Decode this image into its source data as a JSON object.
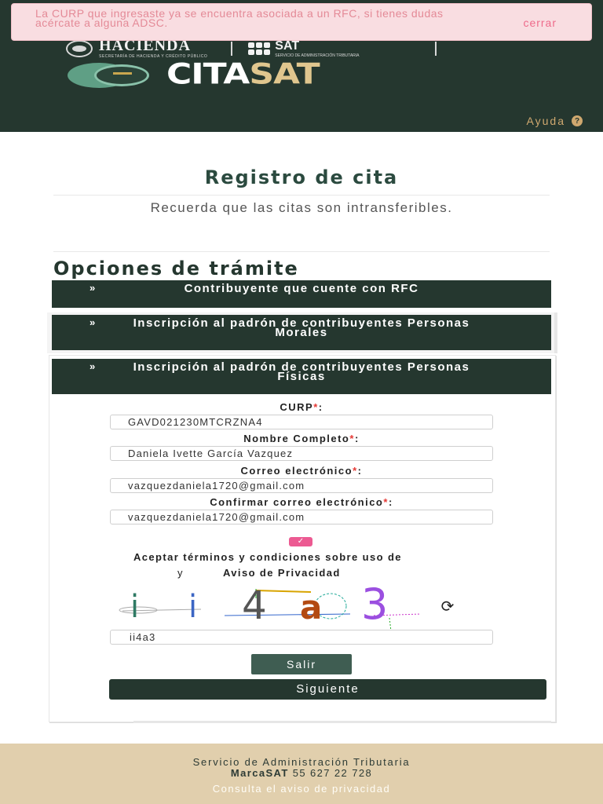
{
  "alert": {
    "message": "La CURP que ingresaste ya se encuentra asociada a un RFC, si tienes dudas acércate a alguna ADSC.",
    "close_label": "cerrar"
  },
  "header": {
    "hacienda_name": "HACIENDA",
    "hacienda_sub": "SECRETARÍA DE HACIENDA Y CRÉDITO PÚBLICO",
    "sat_name": "SAT",
    "sat_sub": "SERVICIO DE ADMINISTRACIÓN TRIBUTARIA",
    "brand_cita": "CITA",
    "brand_sat": "SAT",
    "help_label": "Ayuda",
    "help_icon": "?"
  },
  "main": {
    "title": "Registro de cita",
    "subtitle": "Recuerda que las citas son intransferibles.",
    "section_title": "Opciones de trámite",
    "chevron": "»",
    "accordions": [
      {
        "label": "Contribuyente que cuente con RFC"
      },
      {
        "label": "Inscripción al padrón de contribuyentes Personas Morales"
      },
      {
        "label": "Inscripción al padrón de contribuyentes Personas Físicas"
      }
    ]
  },
  "form": {
    "required_mark": "*",
    "curp_label": "CURP",
    "curp_value": "GAVD021230MTCRZNA4",
    "name_label": "Nombre Completo",
    "name_value": "Daniela Ivette García Vazquez",
    "email_label": "Correo electrónico",
    "email_value": "vazquezdaniela1720@gmail.com",
    "confirm_label": "Confirmar correo electrónico",
    "confirm_value": "vazquezdaniela1720@gmail.com",
    "checkbox_mark": "✓",
    "terms_text": "Aceptar términos y condiciones sobre uso de",
    "terms_y": "y",
    "terms_aviso": "Aviso de Privacidad",
    "captcha_chars": [
      "i",
      "i",
      "4",
      "a",
      "3"
    ],
    "captcha_value": "ii4a3",
    "refresh_icon": "⟳",
    "exit_label": "Salir",
    "next_label": "Siguiente"
  },
  "footer": {
    "org": "Servicio de Administración Tributaria",
    "phone_brand": "MarcaSAT",
    "phone_number": "55 627 22 728",
    "privacy_link": "Consulta el aviso de privacidad"
  },
  "colors": {
    "header_bg": "#25372f",
    "accent_gold": "#e0c68e",
    "alert_bg": "#f9dde1",
    "alert_text": "#e48a97",
    "checkbox_pink": "#ec5a92",
    "footer_bg": "#e1cfad"
  }
}
